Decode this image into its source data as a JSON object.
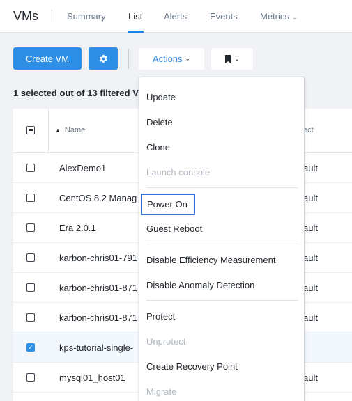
{
  "header": {
    "title": "VMs",
    "tabs": [
      {
        "label": "Summary"
      },
      {
        "label": "List"
      },
      {
        "label": "Alerts"
      },
      {
        "label": "Events"
      },
      {
        "label": "Metrics"
      }
    ]
  },
  "toolbar": {
    "create_label": "Create VM",
    "actions_label": "Actions"
  },
  "selection_info": "1 selected out of 13 filtered V",
  "table": {
    "columns": {
      "name": "Name",
      "project": "ect"
    },
    "rows": [
      {
        "name": "AlexDemo1",
        "project": "ault",
        "checked": false
      },
      {
        "name": "CentOS 8.2 Manag",
        "project": "ault",
        "checked": false
      },
      {
        "name": "Era 2.0.1",
        "project": "ault",
        "checked": false
      },
      {
        "name": "karbon-chris01-791",
        "project": "ault",
        "checked": false
      },
      {
        "name": "karbon-chris01-871",
        "project": "ault",
        "checked": false
      },
      {
        "name": "karbon-chris01-871",
        "project": "ault",
        "checked": false
      },
      {
        "name": "kps-tutorial-single-",
        "project": "",
        "checked": true
      },
      {
        "name": "mysql01_host01",
        "project": "ault",
        "checked": false
      }
    ]
  },
  "actions_menu": {
    "items": [
      {
        "label": "Update",
        "disabled": false
      },
      {
        "label": "Delete",
        "disabled": false
      },
      {
        "label": "Clone",
        "disabled": false
      },
      {
        "label": "Launch console",
        "disabled": true
      },
      {
        "label": "Power On",
        "disabled": false,
        "focused": true
      },
      {
        "label": "Guest Reboot",
        "disabled": false
      },
      {
        "label": "Disable Efficiency Measurement",
        "disabled": false
      },
      {
        "label": "Disable Anomaly Detection",
        "disabled": false
      },
      {
        "label": "Protect",
        "disabled": false
      },
      {
        "label": "Unprotect",
        "disabled": true
      },
      {
        "label": "Create Recovery Point",
        "disabled": false
      },
      {
        "label": "Migrate",
        "disabled": true
      }
    ]
  },
  "colors": {
    "accent": "#2f8fe5",
    "focus_ring": "#3b6fd0",
    "disabled_text": "#b2b9c2"
  },
  "icons": {
    "settings": "gear-icon",
    "bookmark": "bookmark-icon",
    "sort": "sort-asc-icon"
  }
}
